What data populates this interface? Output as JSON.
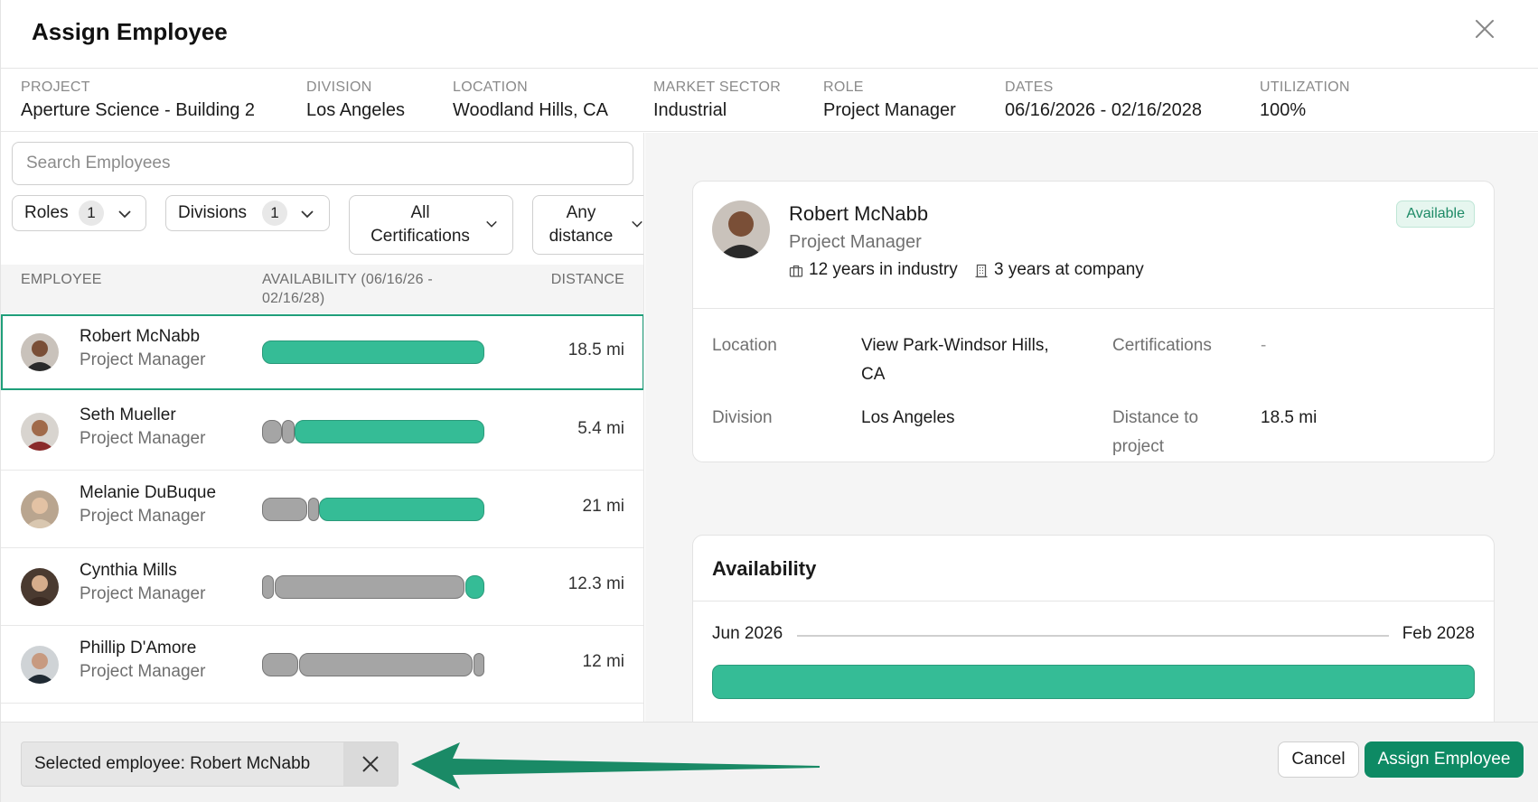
{
  "dialog": {
    "title": "Assign Employee"
  },
  "info": [
    {
      "label": "PROJECT",
      "value": "Aperture Science - Building 2"
    },
    {
      "label": "DIVISION",
      "value": "Los Angeles"
    },
    {
      "label": "LOCATION",
      "value": "Woodland Hills, CA"
    },
    {
      "label": "MARKET SECTOR",
      "value": "Industrial"
    },
    {
      "label": "ROLE",
      "value": "Project Manager"
    },
    {
      "label": "DATES",
      "value": "06/16/2026 - 02/16/2028"
    },
    {
      "label": "UTILIZATION",
      "value": "100%"
    }
  ],
  "search": {
    "placeholder": "Search Employees"
  },
  "filters": {
    "roles": {
      "label": "Roles",
      "count": "1"
    },
    "divisions": {
      "label": "Divisions",
      "count": "1"
    },
    "certifications": {
      "line1": "All",
      "line2": "Certifications"
    },
    "distance": {
      "line1": "Any",
      "line2": "distance"
    }
  },
  "table": {
    "headers": {
      "employee": "EMPLOYEE",
      "availability_1": "AVAILABILITY (06/16/26 -",
      "availability_2": "02/16/28)",
      "distance": "DISTANCE"
    },
    "rows": [
      {
        "name": "Robert McNabb",
        "role": "Project Manager",
        "distance": "18.5 mi"
      },
      {
        "name": "Seth Mueller",
        "role": "Project Manager",
        "distance": "5.4 mi"
      },
      {
        "name": "Melanie DuBuque",
        "role": "Project Manager",
        "distance": "21 mi"
      },
      {
        "name": "Cynthia Mills",
        "role": "Project Manager",
        "distance": "12.3 mi"
      },
      {
        "name": "Phillip D'Amore",
        "role": "Project Manager",
        "distance": "12 mi"
      }
    ]
  },
  "profile": {
    "name": "Robert McNabb",
    "role": "Project Manager",
    "status": "Available",
    "industry": "12 years in industry",
    "company": "3 years at company",
    "location_label": "Location",
    "location_line1": "View Park-Windsor Hills,",
    "location_line2": "CA",
    "certifications_label": "Certifications",
    "certifications_value": "-",
    "division_label": "Division",
    "division_value": "Los Angeles",
    "distance_label_1": "Distance to",
    "distance_label_2": "project",
    "distance_value": "18.5 mi"
  },
  "availability": {
    "title": "Availability",
    "start": "Jun 2026",
    "end": "Feb 2028"
  },
  "footer": {
    "selected": "Selected employee: Robert McNabb",
    "cancel": "Cancel",
    "assign": "Assign Employee"
  },
  "colors": {
    "accent": "#0e8a64",
    "available": "#35bc96",
    "unavailable": "#a5a5a5"
  }
}
